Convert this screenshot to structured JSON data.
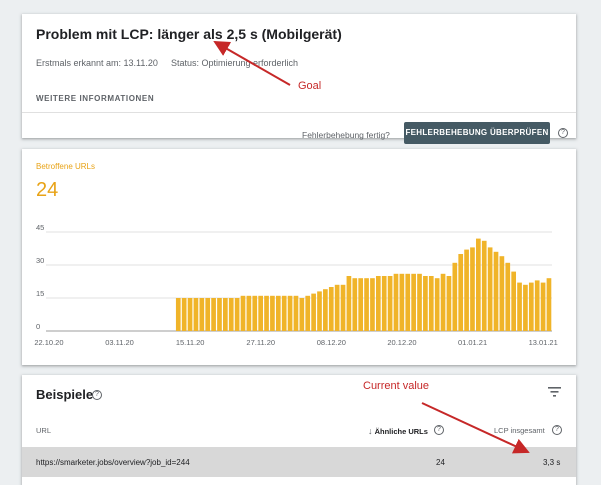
{
  "issue": {
    "title": "Problem mit LCP: länger als 2,5 s (Mobilgerät)",
    "first_detected": "Erstmals erkannt am: 13.11.20",
    "status": "Status: Optimierung erforderlich",
    "more_info": "WEITERE INFORMATIONEN",
    "fix_question": "Fehlerbehebung fertig?",
    "validate_button": "FEHLERBEHEBUNG ÜBERPRÜFEN"
  },
  "summary": {
    "label": "Betroffene URLs",
    "value": "24"
  },
  "chart_data": {
    "type": "bar",
    "color": "#f0b429",
    "ylim": [
      0,
      45
    ],
    "yticks": [
      0,
      15,
      30,
      45
    ],
    "xtick_labels": [
      "22.10.20",
      "03.11.20",
      "15.11.20",
      "27.11.20",
      "08.12.20",
      "20.12.20",
      "01.01.21",
      "13.01.21"
    ],
    "xtick_indices": [
      0,
      12,
      24,
      36,
      48,
      60,
      72,
      84
    ],
    "first_day_index": 0,
    "values": [
      0,
      0,
      0,
      0,
      0,
      0,
      0,
      0,
      0,
      0,
      0,
      0,
      0,
      0,
      0,
      0,
      0,
      0,
      0,
      0,
      0,
      0,
      15,
      15,
      15,
      15,
      15,
      15,
      15,
      15,
      15,
      15,
      15,
      16,
      16,
      16,
      16,
      16,
      16,
      16,
      16,
      16,
      16,
      15,
      16,
      17,
      18,
      19,
      20,
      21,
      21,
      25,
      24,
      24,
      24,
      24,
      25,
      25,
      25,
      26,
      26,
      26,
      26,
      26,
      25,
      25,
      24,
      26,
      25,
      31,
      35,
      37,
      38,
      42,
      41,
      38,
      36,
      34,
      31,
      27,
      22,
      21,
      22,
      23,
      22,
      24
    ]
  },
  "examples": {
    "title": "Beispiele",
    "columns": {
      "url": "URL",
      "similar": "Ähnliche URLs",
      "lcp": "LCP insgesamt"
    },
    "rows": [
      {
        "url": "https://smarketer.jobs/overview?job_id=244",
        "similar": "24",
        "lcp": "3,3 s"
      }
    ]
  },
  "annotations": {
    "goal": "Goal",
    "current": "Current value"
  },
  "colors": {
    "accent": "#e8a317",
    "annotation": "#c62828",
    "button": "#455a64"
  }
}
